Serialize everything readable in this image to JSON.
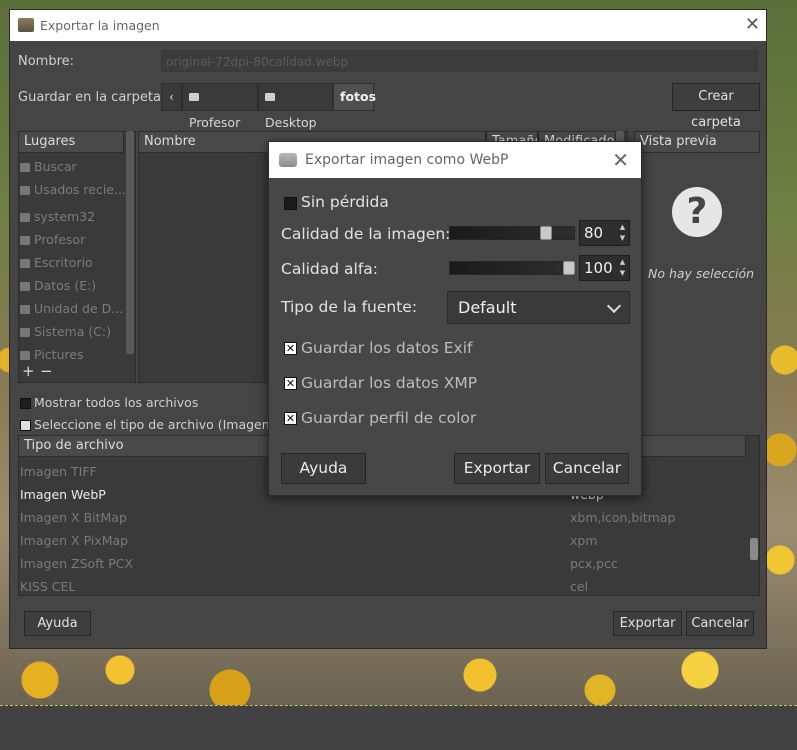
{
  "window": {
    "title": "Exportar la imagen"
  },
  "form": {
    "name_label": "Nombre:",
    "name_value": "original-72dpi-80calidad.webp",
    "folder_label": "Guardar en la carpeta:",
    "path": [
      "Profesor",
      "Desktop",
      "fotos"
    ],
    "create_folder": "Crear carpeta"
  },
  "places": {
    "header": "Lugares",
    "items": [
      "Buscar",
      "Usados recie...",
      "system32",
      "Profesor",
      "Escritorio",
      "Datos (E:)",
      "Unidad de D...",
      "Sistema (C:)",
      "Pictures"
    ],
    "add_glyph": "+",
    "remove_glyph": "−"
  },
  "files": {
    "col_name": "Nombre",
    "col_size": "Tamaño",
    "col_modified": "Modificado"
  },
  "preview": {
    "header": "Vista previa",
    "icon_glyph": "?",
    "empty": "No hay selección"
  },
  "options": {
    "show_all": "Mostrar todos los archivos",
    "select_type": "Seleccione el tipo de archivo (Imagen WebP)"
  },
  "filetypes": {
    "header": "Tipo de archivo",
    "rows": [
      {
        "name": "Imagen TIFF",
        "ext": ""
      },
      {
        "name": "Imagen WebP",
        "ext": "webp"
      },
      {
        "name": "Imagen X BitMap",
        "ext": "xbm,icon,bitmap"
      },
      {
        "name": "Imagen X PixMap",
        "ext": "xpm"
      },
      {
        "name": "Imagen ZSoft PCX",
        "ext": "pcx,pcc"
      },
      {
        "name": "KISS CEL",
        "ext": "cel"
      }
    ]
  },
  "footer": {
    "help": "Ayuda",
    "export": "Exportar",
    "cancel": "Cancelar"
  },
  "webp": {
    "title": "Exportar imagen como WebP",
    "lossless": "Sin pérdida",
    "quality_label": "Calidad de la imagen:",
    "quality_value": "80",
    "quality_fraction": 0.8,
    "alpha_label": "Calidad alfa:",
    "alpha_value": "100",
    "alpha_fraction": 1.0,
    "source_label": "Tipo de la fuente:",
    "source_value": "Default",
    "exif": "Guardar los datos Exif",
    "xmp": "Guardar los datos XMP",
    "color_profile": "Guardar perfil de color",
    "check_glyph": "✕",
    "help": "Ayuda",
    "export": "Exportar",
    "cancel": "Cancelar"
  }
}
